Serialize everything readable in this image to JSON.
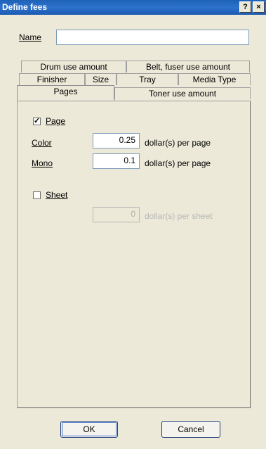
{
  "window": {
    "title": "Define fees",
    "help_label": "?",
    "close_label": "×"
  },
  "name_field": {
    "label": "Name",
    "value": ""
  },
  "tabs": {
    "row1": [
      "Drum use amount",
      "Belt, fuser use amount"
    ],
    "row2": [
      "Finisher",
      "Size",
      "Tray",
      "Media Type"
    ],
    "row3": [
      "Pages",
      "Toner use amount"
    ],
    "active": "Pages"
  },
  "page_section": {
    "checkbox_label": "Page",
    "checked": true,
    "check_mark": "✓",
    "color_label": "Color",
    "color_value": "0.25",
    "mono_label": "Mono",
    "mono_value": "0.1",
    "unit": "dollar(s) per page"
  },
  "sheet_section": {
    "checkbox_label": "Sheet",
    "checked": false,
    "value": "0",
    "unit": "dollar(s) per sheet"
  },
  "buttons": {
    "ok": "OK",
    "cancel": "Cancel"
  }
}
